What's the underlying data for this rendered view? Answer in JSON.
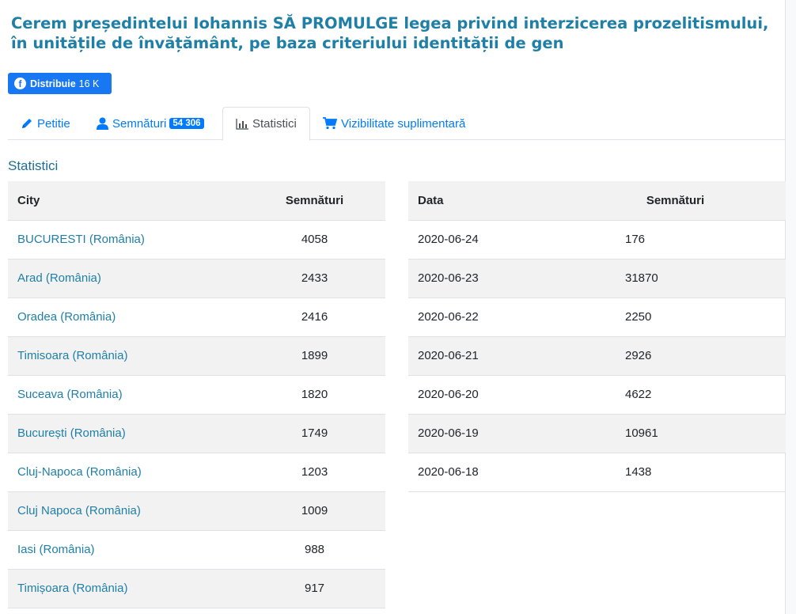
{
  "title": "Cerem președintelui Iohannis SĂ PROMULGE legea privind interzicerea prozelitismului, în unitățile de învățământ, pe baza criteriului identității de gen",
  "share": {
    "label": "Distribuie",
    "count": "16 K",
    "color": "#1877f2"
  },
  "tabs": [
    {
      "label": "Petitie",
      "icon": "pencil-icon"
    },
    {
      "label": "Semnături",
      "icon": "user-icon",
      "badge": "54 306"
    },
    {
      "label": "Statistici",
      "icon": "bar-chart-icon",
      "active": true
    },
    {
      "label": "Vizibilitate suplimentară",
      "icon": "cart-icon"
    }
  ],
  "section_title": "Statistici",
  "city_table": {
    "headers": [
      "City",
      "Semnături"
    ],
    "rows": [
      [
        "BUCURESTI (România)",
        "4058"
      ],
      [
        "Arad (România)",
        "2433"
      ],
      [
        "Oradea (România)",
        "2416"
      ],
      [
        "Timisoara (România)",
        "1899"
      ],
      [
        "Suceava (România)",
        "1820"
      ],
      [
        "București (România)",
        "1749"
      ],
      [
        "Cluj-Napoca (România)",
        "1203"
      ],
      [
        "Cluj Napoca (România)",
        "1009"
      ],
      [
        "Iasi (România)",
        "988"
      ],
      [
        "Timișoara (România)",
        "917"
      ]
    ]
  },
  "date_table": {
    "headers": [
      "Data",
      "Semnături"
    ],
    "rows": [
      [
        "2020-06-24",
        "176"
      ],
      [
        "2020-06-23",
        "31870"
      ],
      [
        "2020-06-22",
        "2250"
      ],
      [
        "2020-06-21",
        "2926"
      ],
      [
        "2020-06-20",
        "4622"
      ],
      [
        "2020-06-19",
        "10961"
      ],
      [
        "2020-06-18",
        "1438"
      ]
    ]
  }
}
